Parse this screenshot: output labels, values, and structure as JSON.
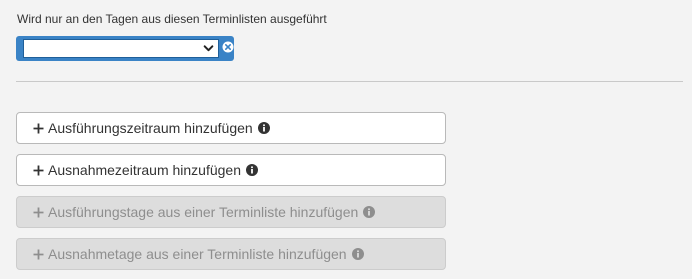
{
  "field": {
    "label": "Wird nur an den Tagen aus diesen Terminlisten ausgeführt",
    "selected_value": "",
    "icons": {
      "dropdown": "chevron-down-icon",
      "clear": "clear-circle-icon"
    }
  },
  "buttons": [
    {
      "label": "Ausführungszeitraum hinzufügen",
      "enabled": true,
      "icon": "plus-icon",
      "hint_icon": "info-icon"
    },
    {
      "label": "Ausnahmezeitraum hinzufügen",
      "enabled": true,
      "icon": "plus-icon",
      "hint_icon": "info-icon"
    },
    {
      "label": "Ausführungstage aus einer Terminliste hinzufügen",
      "enabled": false,
      "icon": "plus-icon",
      "hint_icon": "info-icon"
    },
    {
      "label": "Ausnahmetage aus einer Terminliste hinzufügen",
      "enabled": false,
      "icon": "plus-icon",
      "hint_icon": "info-icon"
    }
  ],
  "colors": {
    "accent": "#3a83c6",
    "background": "#f3f3f3",
    "button_bg": "#ffffff",
    "disabled_bg": "#dddddd",
    "disabled_text": "#8e8e8e"
  }
}
